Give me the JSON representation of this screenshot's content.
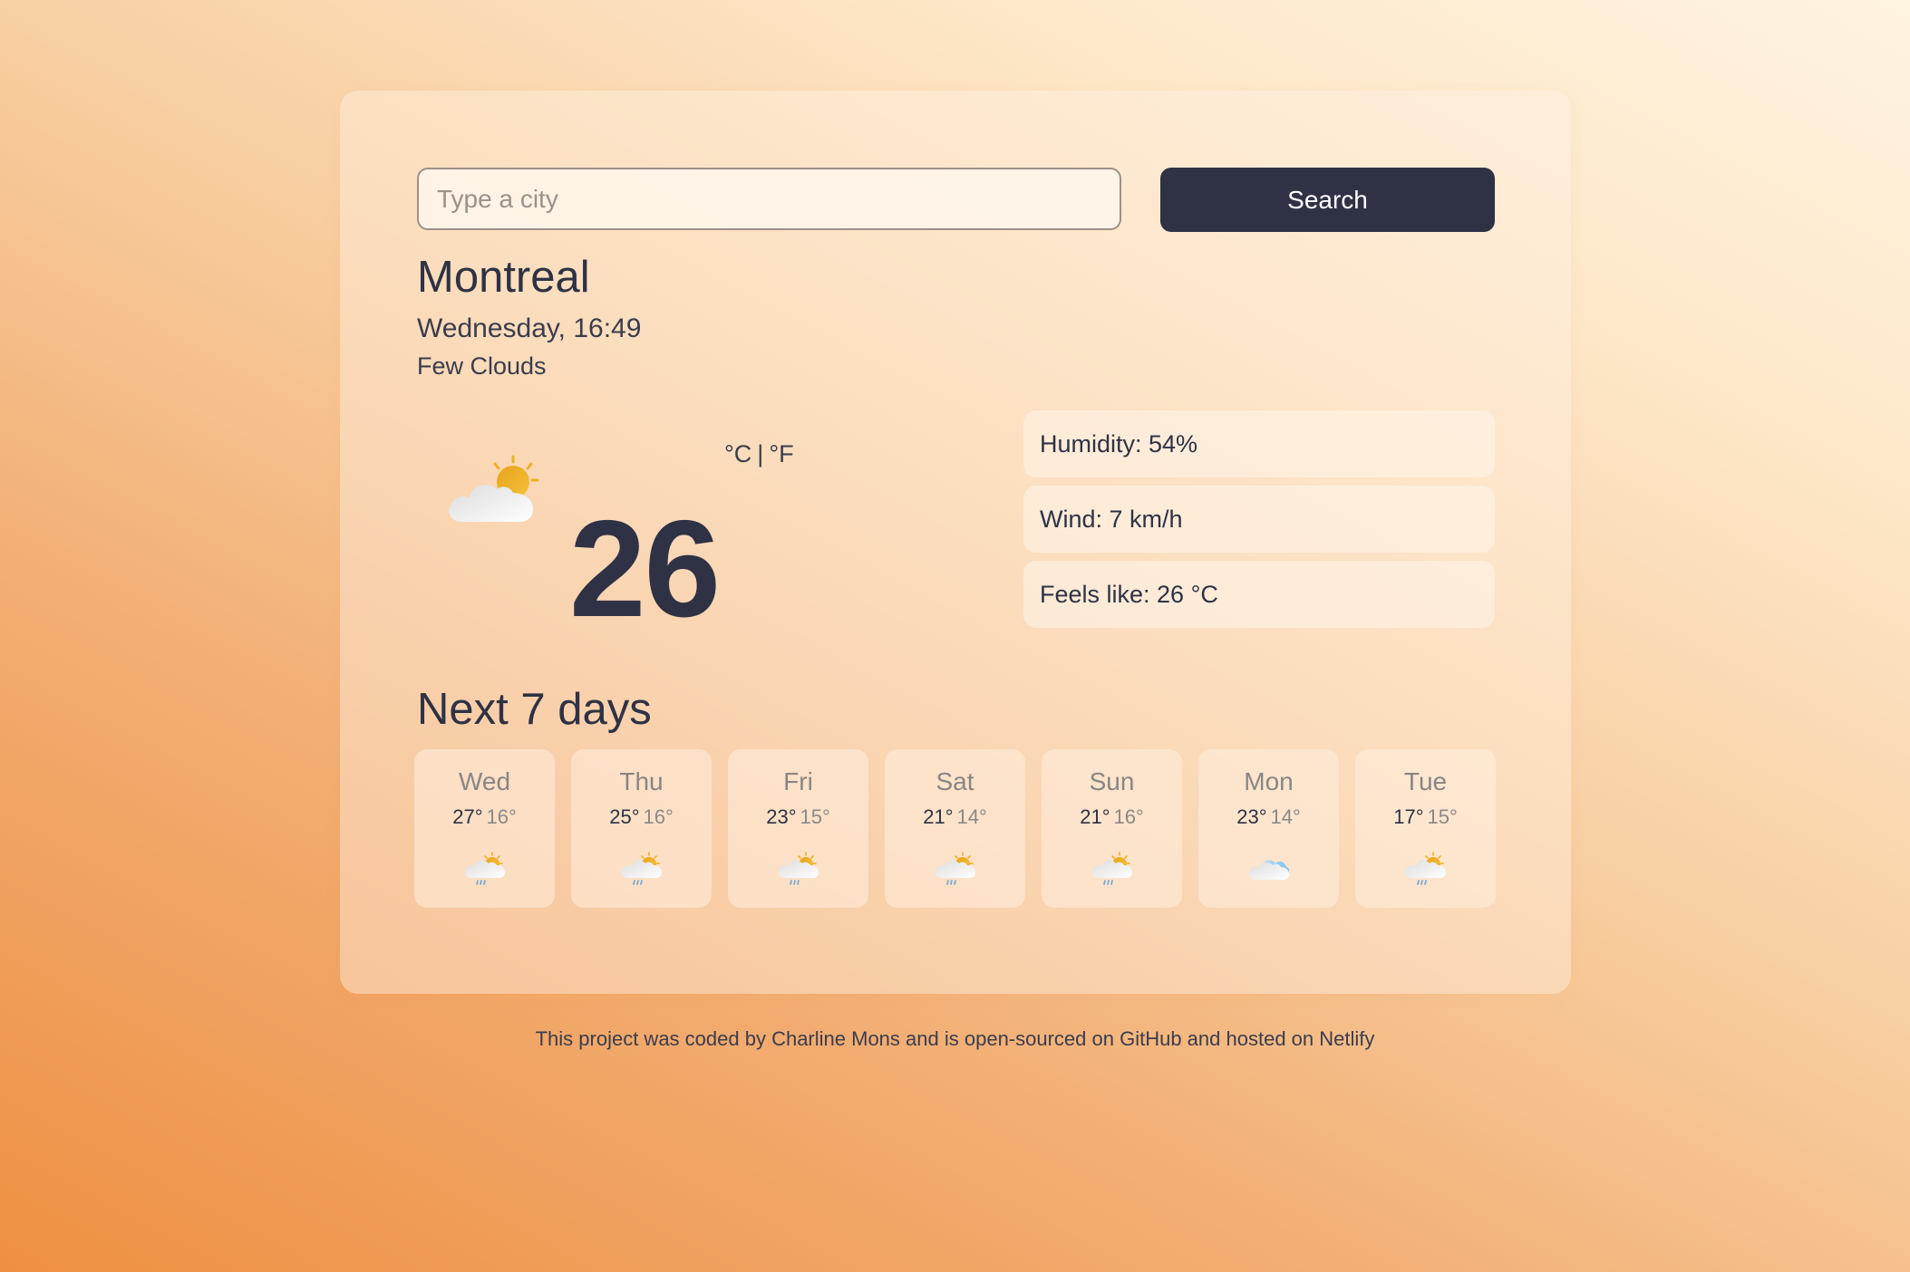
{
  "search": {
    "placeholder": "Type a city",
    "value": "",
    "button_label": "Search"
  },
  "current": {
    "city": "Montreal",
    "datetime": "Wednesday, 16:49",
    "condition": "Few Clouds",
    "icon": "few-clouds-icon",
    "temperature": "26",
    "unit_celsius": "°C",
    "unit_separator": "|",
    "unit_fahrenheit": "°F",
    "details": [
      {
        "label": "Humidity: 54%"
      },
      {
        "label": "Wind: 7 km/h"
      },
      {
        "label": "Feels like: 26 °C"
      }
    ]
  },
  "forecast": {
    "title": "Next 7 days",
    "days": [
      {
        "day": "Wed",
        "max": "27°",
        "min": "16°",
        "icon": "rain-sun-icon"
      },
      {
        "day": "Thu",
        "max": "25°",
        "min": "16°",
        "icon": "rain-sun-icon"
      },
      {
        "day": "Fri",
        "max": "23°",
        "min": "15°",
        "icon": "rain-sun-icon"
      },
      {
        "day": "Sat",
        "max": "21°",
        "min": "14°",
        "icon": "rain-sun-icon"
      },
      {
        "day": "Sun",
        "max": "21°",
        "min": "16°",
        "icon": "rain-sun-icon"
      },
      {
        "day": "Mon",
        "max": "23°",
        "min": "14°",
        "icon": "cloud-icon"
      },
      {
        "day": "Tue",
        "max": "17°",
        "min": "15°",
        "icon": "rain-sun-icon"
      }
    ]
  },
  "footer": {
    "prefix": "This project was coded by ",
    "author": "Charline Mons",
    "middle": " and is ",
    "repo_link": "open-sourced on GitHub",
    "middle2": " and ",
    "host_link": "hosted on Netlify"
  },
  "colors": {
    "primary_dark": "#2f3245",
    "sun": "#efb023",
    "rain": "#6fa6d6",
    "cloud_blue": "#8cc8f2"
  }
}
